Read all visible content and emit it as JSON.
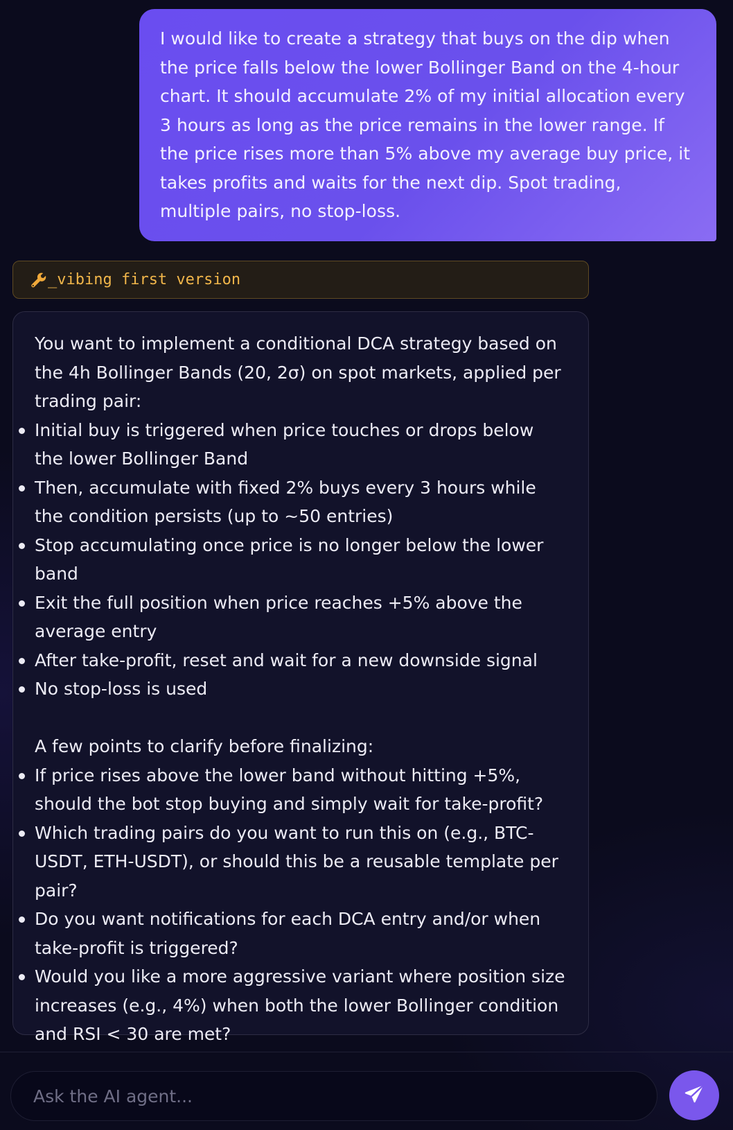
{
  "user_message": {
    "text": "I would like to create a strategy that buys on the dip when the price falls below the lower Bollinger Band on the 4-hour chart. It should accumulate 2% of my initial allocation every 3 hours as long as the price remains in the lower range. If the price rises more than 5% above my average buy price, it takes profits and waits for the next dip. Spot trading, multiple pairs, no stop-loss."
  },
  "tool_status": {
    "icon": "wrench-icon",
    "label": "_vibing first version",
    "color": "#f1b64a"
  },
  "agent_message": {
    "intro": "You want to implement a conditional DCA strategy based on the 4h Bollinger Bands (20, 2σ) on spot markets, applied per trading pair:",
    "points": [
      "Initial buy is triggered when price touches or drops below the lower Bollinger Band",
      "Then, accumulate with fixed 2% buys every 3 hours while the condition persists (up to ~50 entries)",
      "Stop accumulating once price is no longer below the lower band",
      "Exit the full position when price reaches +5% above the average entry",
      "After take-profit, reset and wait for a new downside signal",
      "No stop-loss is used"
    ],
    "clarify_heading": "A few points to clarify before finalizing:",
    "questions": [
      "If price rises above the lower band without hitting +5%, should the bot stop buying and simply wait for take-profit?",
      "Which trading pairs do you want to run this on (e.g., BTC-USDT, ETH-USDT), or should this be a reusable template per pair?",
      "Do you want notifications for each DCA entry and/or when take-profit is triggered?",
      "Would you like a more aggressive variant where position size increases (e.g., 4%) when both the lower Bollinger condition and RSI < 30 are met?"
    ]
  },
  "composer": {
    "placeholder": "Ask the AI agent...",
    "value": "",
    "send_icon": "send-icon",
    "accent": "#7a57ec"
  }
}
